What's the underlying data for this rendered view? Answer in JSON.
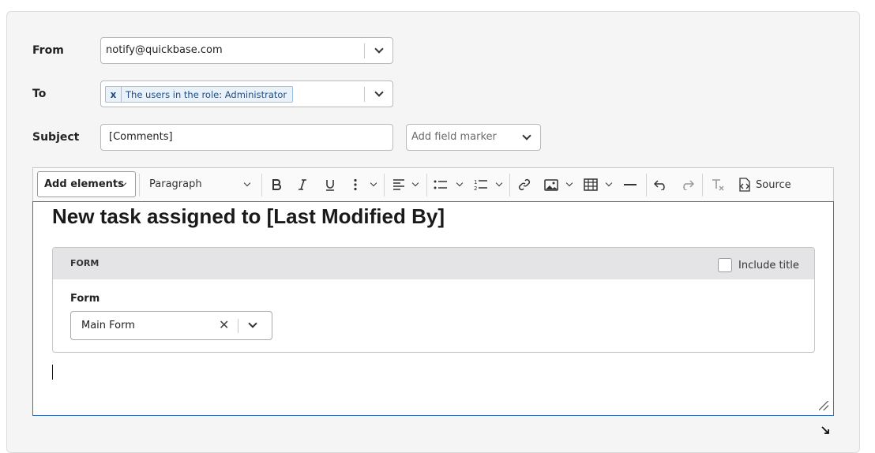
{
  "email": {
    "from_label": "From",
    "from_value": "notify@quickbase.com",
    "to_label": "To",
    "to_chip": "The users in the role: Administrator",
    "to_chip_remove": "x",
    "subject_label": "Subject",
    "subject_value": "[Comments]",
    "marker_placeholder": "Add field marker"
  },
  "toolbar": {
    "add_elements": "Add elements",
    "paragraph": "Paragraph",
    "source": "Source"
  },
  "editor": {
    "heading": "New task assigned to [Last Modified By]",
    "widget_title": "FORM",
    "include_title": "Include title",
    "form_label": "Form",
    "form_value": "Main Form"
  }
}
